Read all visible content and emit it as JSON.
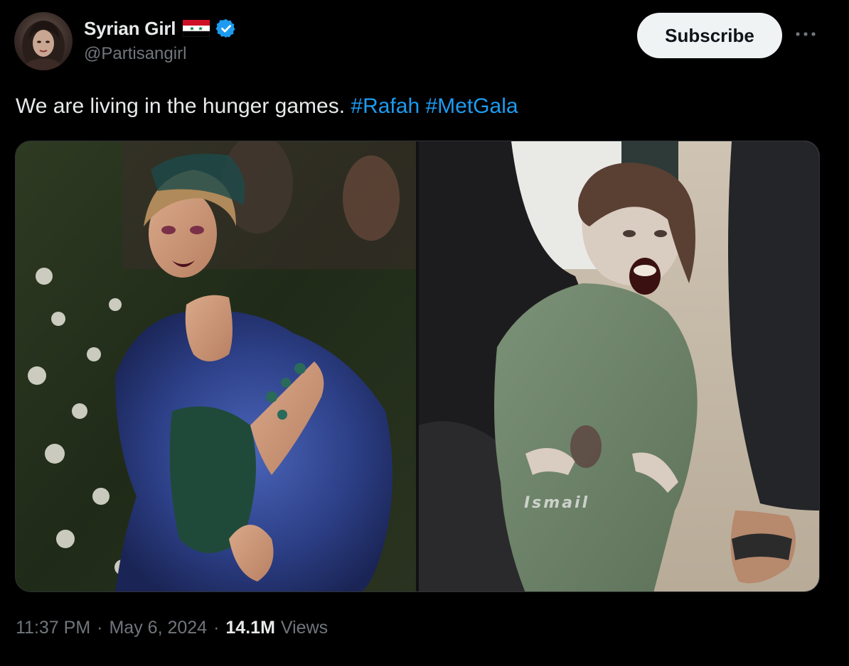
{
  "author": {
    "display_name": "Syrian Girl",
    "handle": "@Partisangirl",
    "flag_icon": "syria-flag-icon",
    "verified_icon": "verified-badge-icon",
    "verified_color": "#1d9bf0"
  },
  "actions": {
    "subscribe_label": "Subscribe",
    "more_icon": "more-horizontal-icon"
  },
  "tweet": {
    "text": "We are living in the hunger games.",
    "hashtags": [
      "#Rafah",
      "#MetGala"
    ],
    "hashtag_color": "#1d9bf0"
  },
  "media": {
    "count": 2,
    "right_watermark": "Ismail"
  },
  "meta": {
    "time": "11:37 PM",
    "separator": "·",
    "date": "May 6, 2024",
    "views_count": "14.1M",
    "views_label": "Views"
  },
  "colors": {
    "background": "#000000",
    "text_primary": "#e7e9ea",
    "text_secondary": "#71767b",
    "accent": "#1d9bf0",
    "button_bg": "#eff3f4"
  }
}
